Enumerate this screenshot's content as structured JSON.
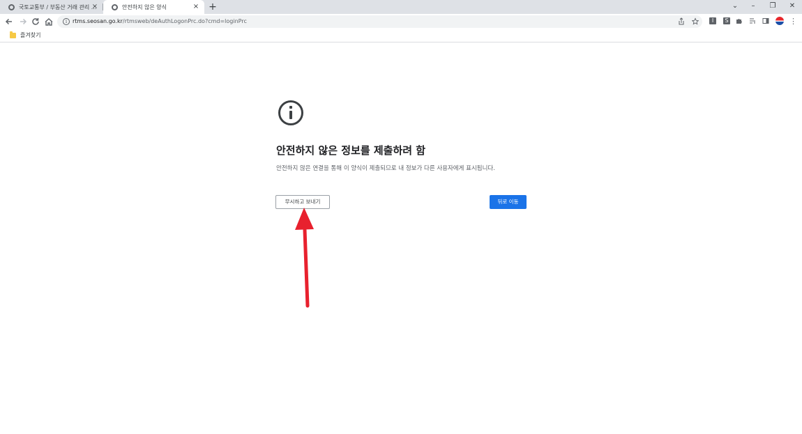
{
  "browser": {
    "tabs": [
      {
        "title": "국토교통부 / 부동산 거래 관리 ...",
        "active": false,
        "close": "×"
      },
      {
        "title": "안전하지 않은 양식",
        "active": true,
        "close": "×"
      }
    ],
    "new_tab": "+",
    "window_controls": {
      "dropdown": "⌄",
      "minimize": "–",
      "restore": "❐",
      "close": "✕"
    },
    "url_host": "rtms.seosan.go.kr",
    "url_path": "/rtmsweb/deAuthLogonPrc.do?cmd=loginPrc",
    "extensions": [
      "I",
      "S"
    ],
    "bookmark": "즐겨찾기"
  },
  "page": {
    "heading": "안전하지 않은 정보를 제출하려 함",
    "description": "안전하지 않은 연결을 통해 이 양식이 제출되므로 내 정보가 다른 사용자에게 표시됩니다.",
    "send_anyway_label": "무시하고 보내기",
    "go_back_label": "뒤로 이동"
  },
  "colors": {
    "accent": "#1a73e8",
    "annotation_arrow": "#e8212e"
  }
}
